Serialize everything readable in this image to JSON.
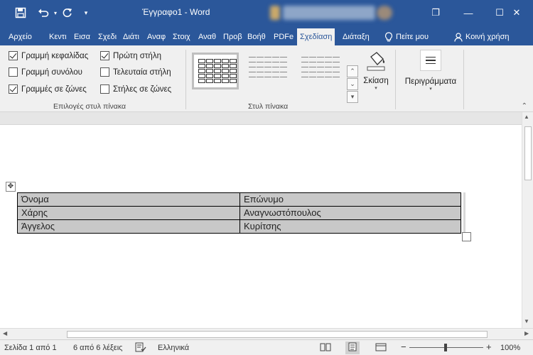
{
  "titlebar": {
    "title": "Έγγραφο1  -  Word",
    "restore_glyph": "❐",
    "minimize_glyph": "—",
    "maximize_glyph": "☐",
    "close_glyph": "✕",
    "undo_dd_glyph": "▾",
    "customize_glyph": "▾"
  },
  "tabs": [
    {
      "label": "Αρχείο"
    },
    {
      "label": "Κεντι"
    },
    {
      "label": "Εισα"
    },
    {
      "label": "Σχεδι"
    },
    {
      "label": "Διάτι"
    },
    {
      "label": "Αναφ"
    },
    {
      "label": "Στοιχ"
    },
    {
      "label": "Αναθ"
    },
    {
      "label": "Προβ"
    },
    {
      "label": "Βοήθ"
    },
    {
      "label": "PDFe"
    },
    {
      "label": "Σχεδίαση",
      "active": true
    },
    {
      "label": "Διάταξη"
    },
    {
      "label": "Πείτε μου"
    },
    {
      "label": "Κοινή χρήση"
    }
  ],
  "ribbon": {
    "options": [
      {
        "label": "Γραμμή κεφαλίδας",
        "checked": true
      },
      {
        "label": "Γραμμή συνόλου",
        "checked": false
      },
      {
        "label": "Γραμμές σε ζώνες",
        "checked": true
      },
      {
        "label": "Πρώτη στήλη",
        "checked": true
      },
      {
        "label": "Τελευταία στήλη",
        "checked": false
      },
      {
        "label": "Στήλες σε ζώνες",
        "checked": false
      }
    ],
    "options_group_label": "Επιλογές στυλ πίνακα",
    "styles_group_label": "Στυλ πίνακα",
    "shading_label": "Σκίαση",
    "borders_label": "Περιγράμματα",
    "dropdown_caret": "▾",
    "collapse_glyph": "⌃",
    "gallery_up": "⌃",
    "gallery_down": "⌄",
    "gallery_more": "▾"
  },
  "table": {
    "rows": [
      [
        "Όνομα",
        "Επώνυμο"
      ],
      [
        "Χάρης",
        "Αναγνωστόπουλος"
      ],
      [
        "Άγγελος",
        "Κυρίτσης"
      ]
    ]
  },
  "scroll": {
    "up": "▲",
    "down": "▼",
    "left": "◀",
    "right": "▶"
  },
  "statusbar": {
    "page": "Σελίδα 1 από 1",
    "words": "6 από 6 λέξεις",
    "language": "Ελληνικά",
    "zoom_minus": "−",
    "zoom_plus": "+",
    "zoom": "100%"
  },
  "colors": {
    "brand": "#2b579a",
    "table_fill": "#c8c8c8"
  }
}
